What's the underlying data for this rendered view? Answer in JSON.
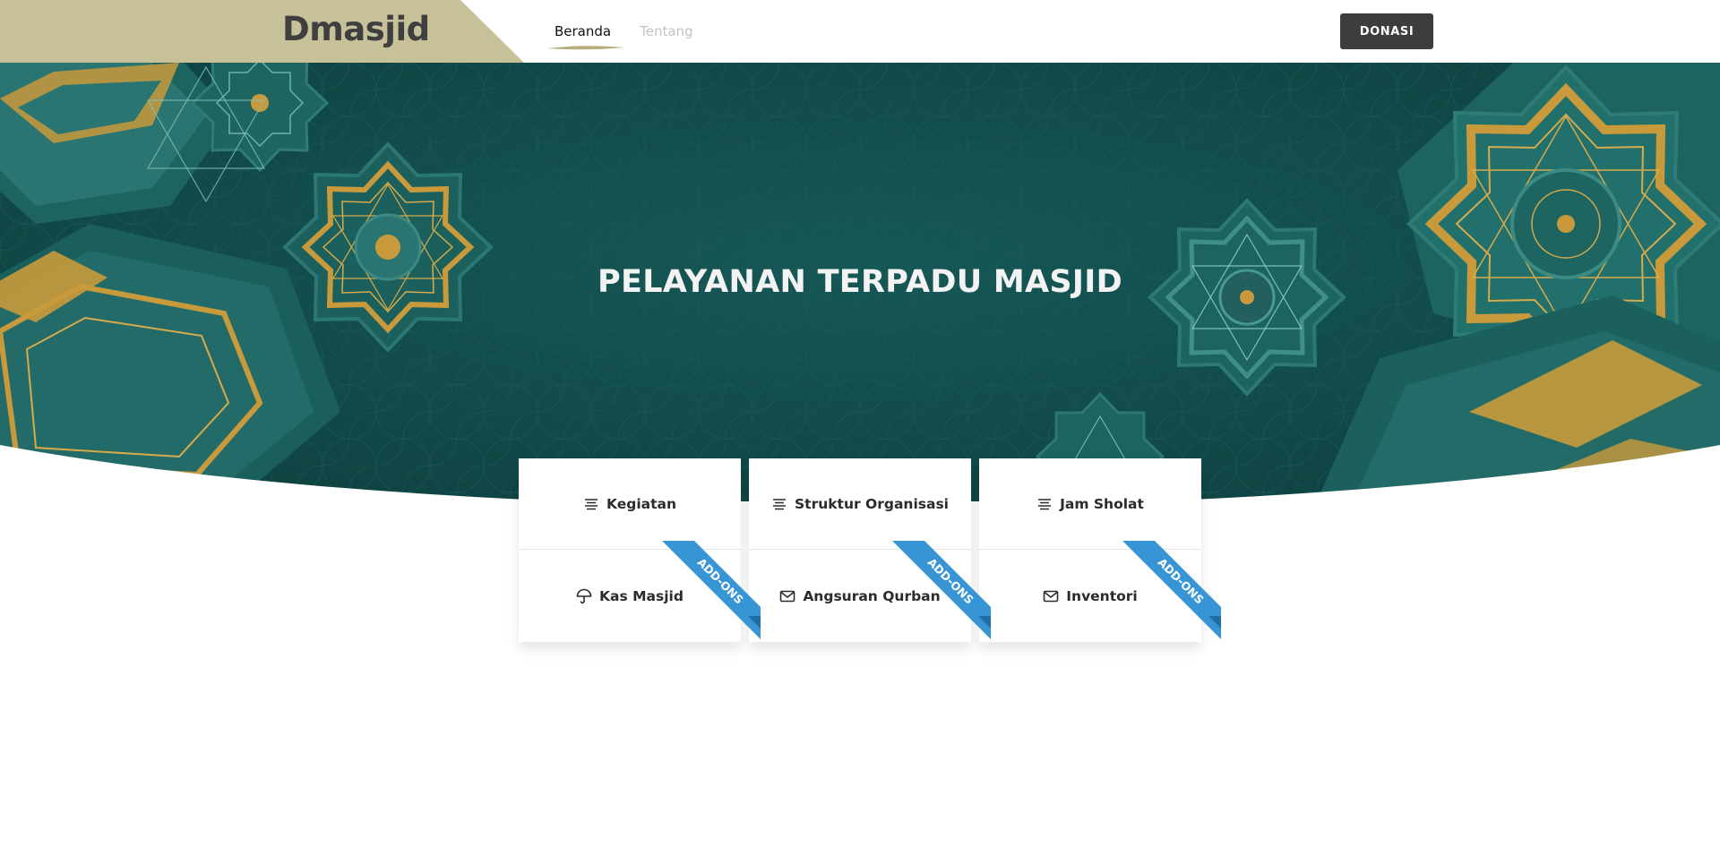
{
  "header": {
    "brand": "Dmasjid",
    "nav": [
      {
        "label": "Beranda",
        "active": true
      },
      {
        "label": "Tentang",
        "active": false
      }
    ],
    "donate_label": "DONASI"
  },
  "hero": {
    "title": "PELAYANAN TERPADU MASJID"
  },
  "services": [
    {
      "label": "Kegiatan",
      "icon": "list-icon",
      "addon": false
    },
    {
      "label": "Struktur Organisasi",
      "icon": "list-icon",
      "addon": false
    },
    {
      "label": "Jam Sholat",
      "icon": "list-icon",
      "addon": false
    },
    {
      "label": "Kas Masjid",
      "icon": "umbrella-icon",
      "addon": true
    },
    {
      "label": "Angsuran Qurban",
      "icon": "mail-icon",
      "addon": true
    },
    {
      "label": "Inventori",
      "icon": "mail-icon",
      "addon": true
    }
  ],
  "addon_label": "ADD-ONS",
  "colors": {
    "brand_panel": "#c7c19a",
    "hero_teal": "#144e4d",
    "gold": "#c99a3b",
    "donate_button": "#3d3d3d",
    "ribbon": "#3795d6"
  }
}
